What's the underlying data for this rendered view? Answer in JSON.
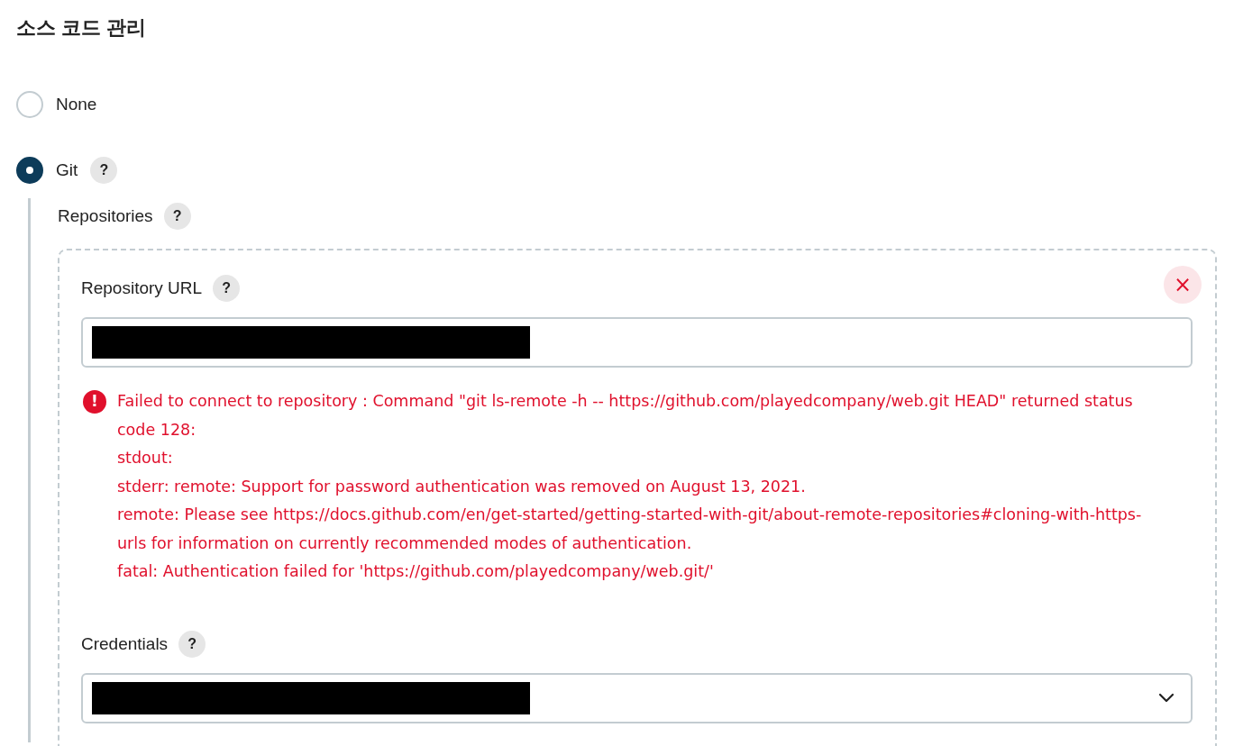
{
  "heading": "소스 코드 관리",
  "options": [
    {
      "label": "None",
      "selected": false
    },
    {
      "label": "Git",
      "selected": true,
      "help": "?"
    }
  ],
  "repositories": {
    "label": "Repositories",
    "help": "?",
    "url": {
      "label": "Repository URL",
      "help": "?",
      "redacted": true
    },
    "remove": "×",
    "error": {
      "icon": "!",
      "lines": [
        "Failed to connect to repository : Command \"git ls-remote -h -- https://github.com/playedcompany/web.git HEAD\" returned status code 128:",
        "stdout:",
        "stderr: remote: Support for password authentication was removed on August 13, 2021.",
        "remote: Please see https://docs.github.com/en/get-started/getting-started-with-git/about-remote-repositories#cloning-with-https-urls for information on currently recommended modes of authentication.",
        "fatal: Authentication failed for 'https://github.com/playedcompany/web.git/'"
      ]
    },
    "credentials": {
      "label": "Credentials",
      "help": "?",
      "redacted": true
    }
  }
}
